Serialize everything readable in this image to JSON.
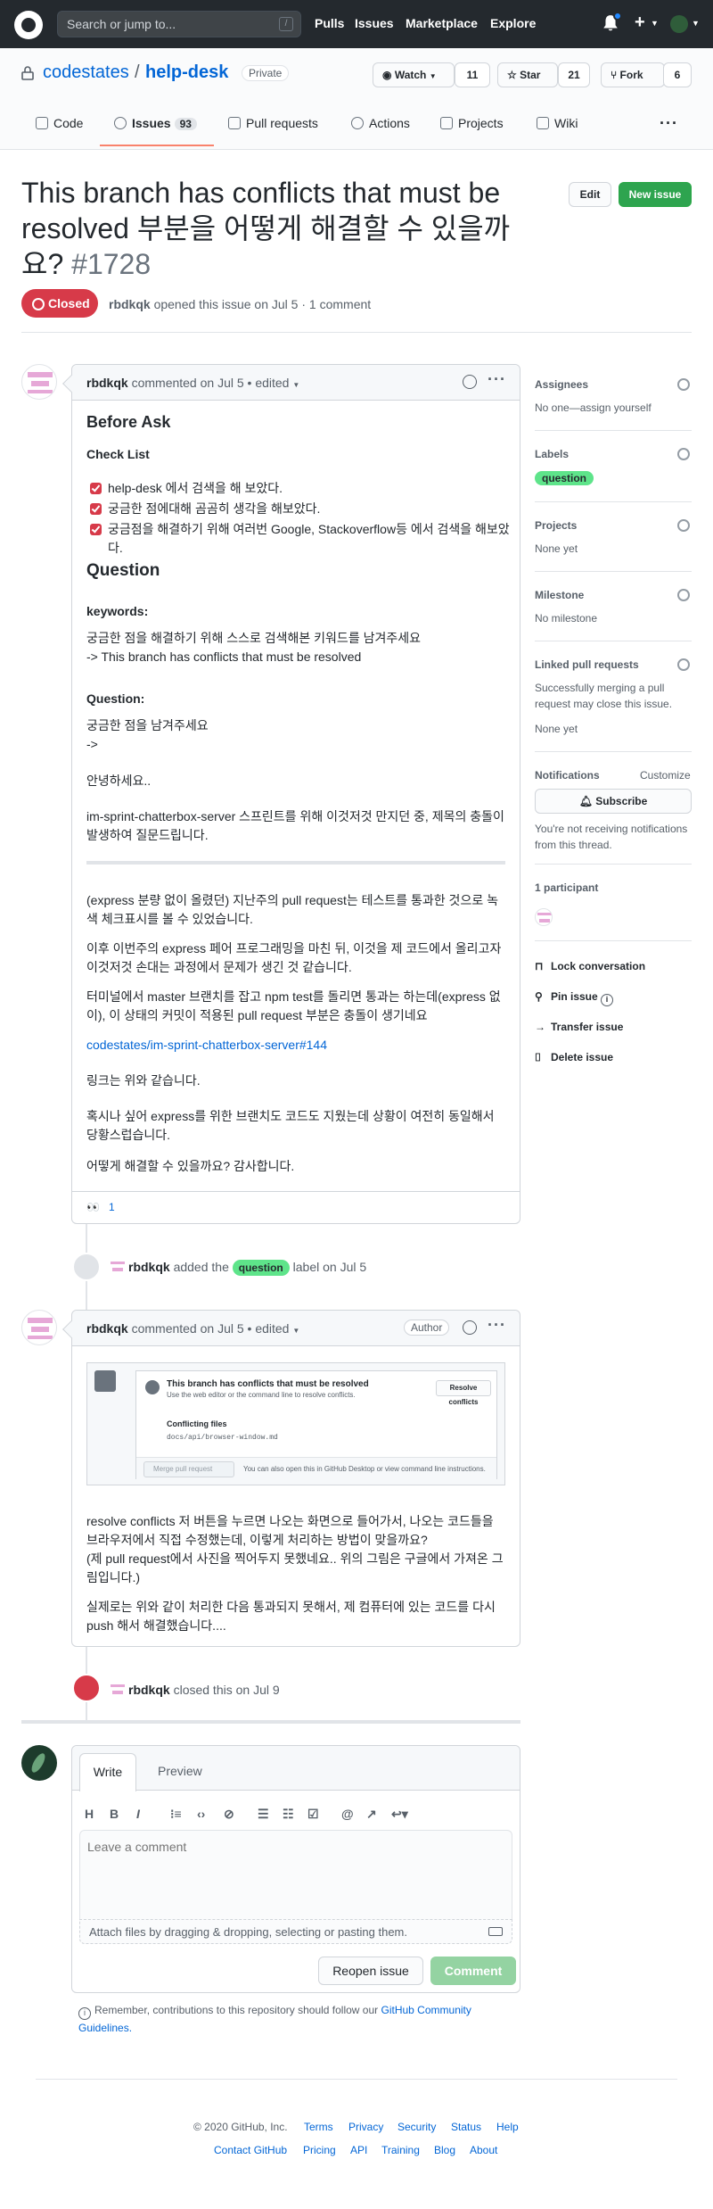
{
  "header": {
    "search_placeholder": "Search or jump to...",
    "slash_hint": "/",
    "nav": [
      "Pulls",
      "Issues",
      "Marketplace",
      "Explore"
    ]
  },
  "repo": {
    "owner": "codestates",
    "name": "help-desk",
    "visibility": "Private",
    "watch_label": "Watch",
    "watch_count": "11",
    "star_label": "Star",
    "star_count": "21",
    "fork_label": "Fork",
    "fork_count": "6",
    "tabs": [
      {
        "label": "Code",
        "icon": "code-icon"
      },
      {
        "label": "Issues",
        "icon": "issue-icon",
        "count": "93"
      },
      {
        "label": "Pull requests",
        "icon": "pull-request-icon"
      },
      {
        "label": "Actions",
        "icon": "play-icon"
      },
      {
        "label": "Projects",
        "icon": "project-icon"
      },
      {
        "label": "Wiki",
        "icon": "book-icon"
      }
    ]
  },
  "issue": {
    "title": "This branch has conflicts that must be resolved 부분을 어떻게 해결할 수 있을까요?",
    "number": "#1728",
    "edit_label": "Edit",
    "new_issue_label": "New issue",
    "state": "Closed",
    "author": "rbdkqk",
    "meta": "opened this issue on Jul 5 · 1 comment"
  },
  "comment1": {
    "author": "rbdkqk",
    "meta": "commented on Jul 5 • edited",
    "before_ask": "Before Ask",
    "checklist_title": "Check List",
    "checklist": [
      "help-desk 에서 검색을 해 보았다.",
      "궁금한 점에대해 곰곰히 생각을 해보았다.",
      "궁금점을 해결하기 위해 여러번 Google, Stackoverflow등 에서 검색을 해보았다."
    ],
    "question_heading": "Question",
    "keywords_label": "keywords:",
    "keywords_line1": "궁금한 점을 해결하기 위해 스스로 검색해본 키워드를 남겨주세요",
    "keywords_line2": "-> This branch has conflicts that must be resolved",
    "question_label": "Question:",
    "question_line1": "궁금한 점을 남겨주세요",
    "question_line2": "->",
    "hello": "안녕하세요..",
    "p1": "im-sprint-chatterbox-server 스프린트를 위해 이것저것 만지던 중, 제목의 충돌이 발생하여 질문드립니다.",
    "p2": "(express 분량 없이 올렸던) 지난주의 pull request는 테스트를 통과한 것으로 녹색 체크표시를 볼 수 있었습니다.",
    "p3": "이후 이번주의 express 페어 프로그래밍을 마친 뒤, 이것을 제 코드에서 올리고자 이것저것 손대는 과정에서 문제가 생긴 것 같습니다.",
    "p4": "터미널에서 master 브랜치를 잡고 npm test를 돌리면 통과는 하는데(express 없이), 이 상태의 커밋이 적용된 pull request 부분은 충돌이 생기네요",
    "link": "codestates/im-sprint-chatterbox-server#144",
    "p5": "링크는 위와 같습니다.",
    "p6": "혹시나 싶어 express를 위한 브랜치도 코드도 지웠는데 상황이 여전히 동일해서 당황스럽습니다.",
    "p7": "어떻게 해결할 수 있을까요? 감사합니다.",
    "reaction_emoji": "👀",
    "reaction_count": "1"
  },
  "label_event": {
    "actor": "rbdkqk",
    "before": "added the",
    "label": "question",
    "after": "label on Jul 5"
  },
  "comment2": {
    "author": "rbdkqk",
    "meta": "commented on Jul 5 • edited",
    "author_tag": "Author",
    "shot": {
      "title": "This branch has conflicts that must be resolved",
      "subtitle": "Use the web editor or the command line to resolve conflicts.",
      "button": "Resolve conflicts",
      "files_label": "Conflicting files",
      "file": "docs/api/browser-window.md",
      "merge": "Merge pull request",
      "foot": "You can also open this in GitHub Desktop or view command line instructions."
    },
    "p1": "resolve conflicts 저 버튼을 누르면 나오는 화면으로 들어가서, 나오는 코드들을 브라우저에서 직접 수정했는데, 이렇게 처리하는 방법이 맞을까요?",
    "p1b": "(제 pull request에서 사진을 찍어두지 못했네요.. 위의 그림은 구글에서 가져온 그림입니다.)",
    "p2": "실제로는 위와 같이 처리한 다음 통과되지 못해서, 제 컴퓨터에 있는 코드를 다시 push 해서 해결했습니다...."
  },
  "close_event": {
    "actor": "rbdkqk",
    "text": "closed this on Jul 9"
  },
  "new_comment": {
    "write_tab": "Write",
    "preview_tab": "Preview",
    "toolbar": [
      "H",
      "B",
      "I",
      "quote",
      "code",
      "link",
      "ul",
      "ol",
      "task",
      "@",
      "ref",
      "reply"
    ],
    "placeholder": "Leave a comment",
    "attach": "Attach files by dragging & dropping, selecting or pasting them.",
    "reopen": "Reopen issue",
    "comment": "Comment",
    "remember": "Remember, contributions to this repository should follow our",
    "guidelines": "GitHub Community Guidelines."
  },
  "sidebar": {
    "assignees_title": "Assignees",
    "assignees_value": "No one—assign yourself",
    "labels_title": "Labels",
    "labels_value": "question",
    "projects_title": "Projects",
    "projects_value": "None yet",
    "milestone_title": "Milestone",
    "milestone_value": "No milestone",
    "linked_title": "Linked pull requests",
    "linked_desc": "Successfully merging a pull request may close this issue.",
    "linked_value": "None yet",
    "notifications_title": "Notifications",
    "customize": "Customize",
    "subscribe": "Subscribe",
    "notif_desc": "You're not receiving notifications from this thread.",
    "participants": "1 participant",
    "lock": "Lock conversation",
    "pin": "Pin issue",
    "transfer": "Transfer issue",
    "delete": "Delete issue"
  },
  "footer": {
    "copyright": "© 2020 GitHub, Inc.",
    "row1": [
      "Terms",
      "Privacy",
      "Security",
      "Status",
      "Help"
    ],
    "row2": [
      "Contact GitHub",
      "Pricing",
      "API",
      "Training",
      "Blog",
      "About"
    ]
  },
  "colors": {
    "closed": "#d73a49",
    "label_question": "#5ee48a",
    "new_issue": "#2ea44f",
    "link": "#0366d6"
  }
}
